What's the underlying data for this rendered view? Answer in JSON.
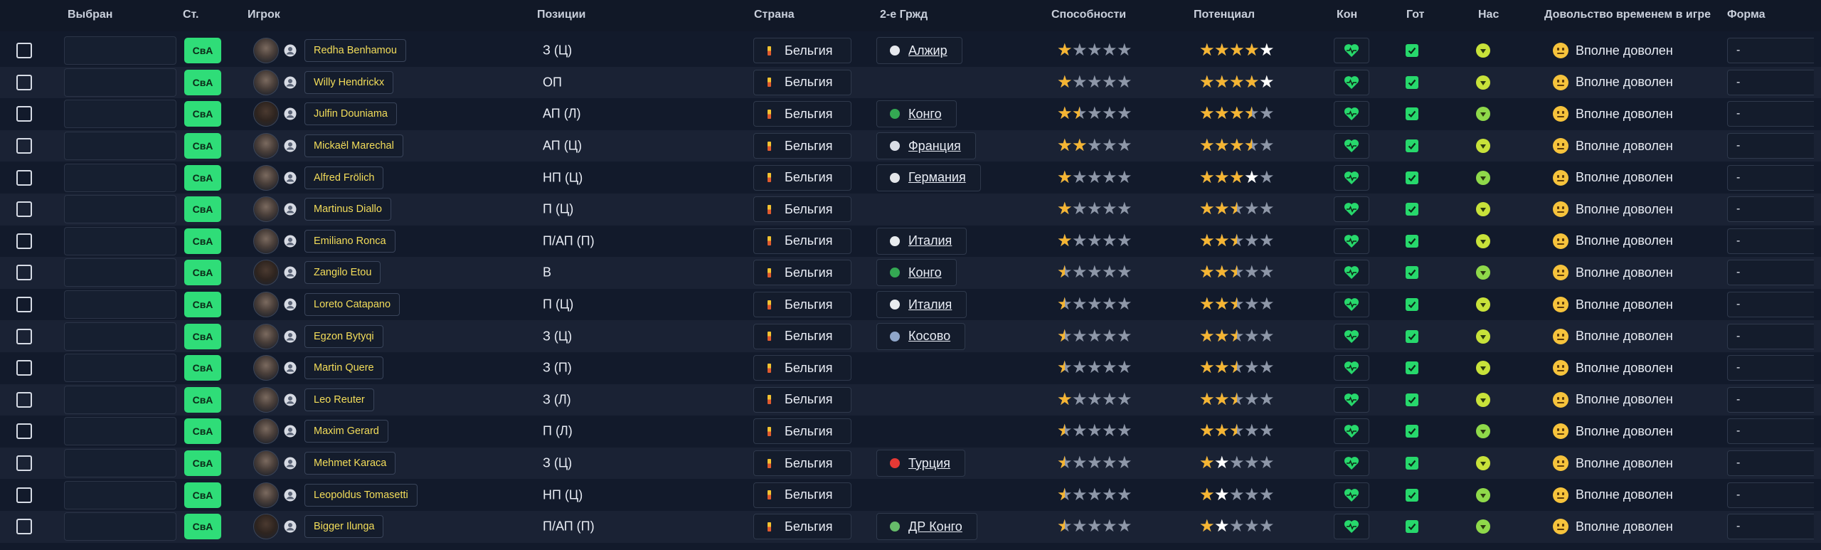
{
  "columns": {
    "selected": "Выбран",
    "status": "Ст.",
    "player": "Игрок",
    "positions": "Позиции",
    "nation": "Страна",
    "second_nation": "2-е Гржд",
    "ability": "Способности",
    "potential": "Потенциал",
    "condition": "Кон",
    "ready": "Гот",
    "mood": "Нас",
    "playtime": "Довольство временем в игре",
    "form": "Форма"
  },
  "colors": {
    "status_green": "#2fdd78",
    "star_gold": "#f5b533",
    "name_yellow": "#f3dd5a",
    "heart_green": "#27d86c",
    "mood_yellow": "#c8e23a",
    "mood_green": "#8fd94a"
  },
  "players": [
    {
      "status": "СвА",
      "name": "Redha Benhamou",
      "positions": "З (Ц)",
      "nation": "Бельгия",
      "second": "Алжир",
      "sflag": "#e7e9ee",
      "ability": 1,
      "potential": 4,
      "potential_white": 1,
      "mood": "yellow",
      "playtime": "Вполне доволен",
      "form": "-",
      "dark": false
    },
    {
      "status": "СвА",
      "name": "Willy Hendrickx",
      "positions": "ОП",
      "nation": "Бельгия",
      "second": "",
      "sflag": "",
      "ability": 1,
      "potential": 4,
      "potential_white": 1,
      "mood": "yellow",
      "playtime": "Вполне доволен",
      "form": "-",
      "dark": false
    },
    {
      "status": "СвА",
      "name": "Julfin Douniama",
      "positions": "АП (Л)",
      "nation": "Бельгия",
      "second": "Конго",
      "sflag": "#34a853",
      "ability": 1.5,
      "potential": 3.5,
      "potential_white": 0,
      "mood": "green",
      "playtime": "Вполне доволен",
      "form": "-",
      "dark": true
    },
    {
      "status": "СвА",
      "name": "Mickaël Marechal",
      "positions": "АП (Ц)",
      "nation": "Бельгия",
      "second": "Франция",
      "sflag": "#d9dde6",
      "ability": 2,
      "potential": 3.5,
      "potential_white": 0,
      "mood": "yellow",
      "playtime": "Вполне доволен",
      "form": "-",
      "dark": false
    },
    {
      "status": "СвА",
      "name": "Alfred Frölich",
      "positions": "НП (Ц)",
      "nation": "Бельгия",
      "second": "Германия",
      "sflag": "#e4e6ea",
      "ability": 1,
      "potential": 3,
      "potential_white": 1,
      "mood": "green",
      "playtime": "Вполне доволен",
      "form": "-",
      "dark": false
    },
    {
      "status": "СвА",
      "name": "Martinus Diallo",
      "positions": "П (Ц)",
      "nation": "Бельгия",
      "second": "",
      "sflag": "",
      "ability": 1,
      "potential": 2.5,
      "potential_white": 0,
      "mood": "yellow",
      "playtime": "Вполне доволен",
      "form": "-",
      "dark": false
    },
    {
      "status": "СвА",
      "name": "Emiliano Ronca",
      "positions": "П/АП (П)",
      "nation": "Бельгия",
      "second": "Италия",
      "sflag": "#e9ecef",
      "ability": 1,
      "potential": 2.5,
      "potential_white": 0,
      "mood": "yellow",
      "playtime": "Вполне доволен",
      "form": "-",
      "dark": false
    },
    {
      "status": "СвА",
      "name": "Zangilo Etou",
      "positions": "В",
      "nation": "Бельгия",
      "second": "Конго",
      "sflag": "#34a853",
      "ability": 0.5,
      "potential": 2.5,
      "potential_white": 0,
      "mood": "green",
      "playtime": "Вполне доволен",
      "form": "-",
      "dark": true
    },
    {
      "status": "СвА",
      "name": "Loreto Catapano",
      "positions": "П (Ц)",
      "nation": "Бельгия",
      "second": "Италия",
      "sflag": "#e9ecef",
      "ability": 0.5,
      "potential": 2.5,
      "potential_white": 0,
      "mood": "yellow",
      "playtime": "Вполне доволен",
      "form": "-",
      "dark": false
    },
    {
      "status": "СвА",
      "name": "Egzon Bytyqi",
      "positions": "З (Ц)",
      "nation": "Бельгия",
      "second": "Косово",
      "sflag": "#8fa6c9",
      "ability": 0.5,
      "potential": 2.5,
      "potential_white": 0,
      "mood": "yellow",
      "playtime": "Вполне доволен",
      "form": "-",
      "dark": false
    },
    {
      "status": "СвА",
      "name": "Martin Quere",
      "positions": "З (П)",
      "nation": "Бельгия",
      "second": "",
      "sflag": "",
      "ability": 0.5,
      "potential": 2.5,
      "potential_white": 0,
      "mood": "yellow",
      "playtime": "Вполне доволен",
      "form": "-",
      "dark": false
    },
    {
      "status": "СвА",
      "name": "Leo Reuter",
      "positions": "З (Л)",
      "nation": "Бельгия",
      "second": "",
      "sflag": "",
      "ability": 1,
      "potential": 2.5,
      "potential_white": 0,
      "mood": "yellow",
      "playtime": "Вполне доволен",
      "form": "-",
      "dark": false
    },
    {
      "status": "СвА",
      "name": "Maxim Gerard",
      "positions": "П (Л)",
      "nation": "Бельгия",
      "second": "",
      "sflag": "",
      "ability": 0.5,
      "potential": 2.5,
      "potential_white": 0,
      "mood": "green",
      "playtime": "Вполне доволен",
      "form": "-",
      "dark": false
    },
    {
      "status": "СвА",
      "name": "Mehmet Karaca",
      "positions": "З (Ц)",
      "nation": "Бельгия",
      "second": "Турция",
      "sflag": "#e53935",
      "ability": 0.5,
      "potential": 1,
      "potential_white": 1,
      "mood": "yellow",
      "playtime": "Вполне доволен",
      "form": "-",
      "dark": false
    },
    {
      "status": "СвА",
      "name": "Leopoldus Tomasetti",
      "positions": "НП (Ц)",
      "nation": "Бельгия",
      "second": "",
      "sflag": "",
      "ability": 0.5,
      "potential": 1,
      "potential_white": 1,
      "mood": "green",
      "playtime": "Вполне доволен",
      "form": "-",
      "dark": false
    },
    {
      "status": "СвА",
      "name": "Bigger Ilunga",
      "positions": "П/АП (П)",
      "nation": "Бельгия",
      "second": "ДР Конго",
      "sflag": "#66bb6a",
      "ability": 0.5,
      "potential": 1,
      "potential_white": 1,
      "mood": "green",
      "playtime": "Вполне доволен",
      "form": "-",
      "dark": true
    }
  ]
}
